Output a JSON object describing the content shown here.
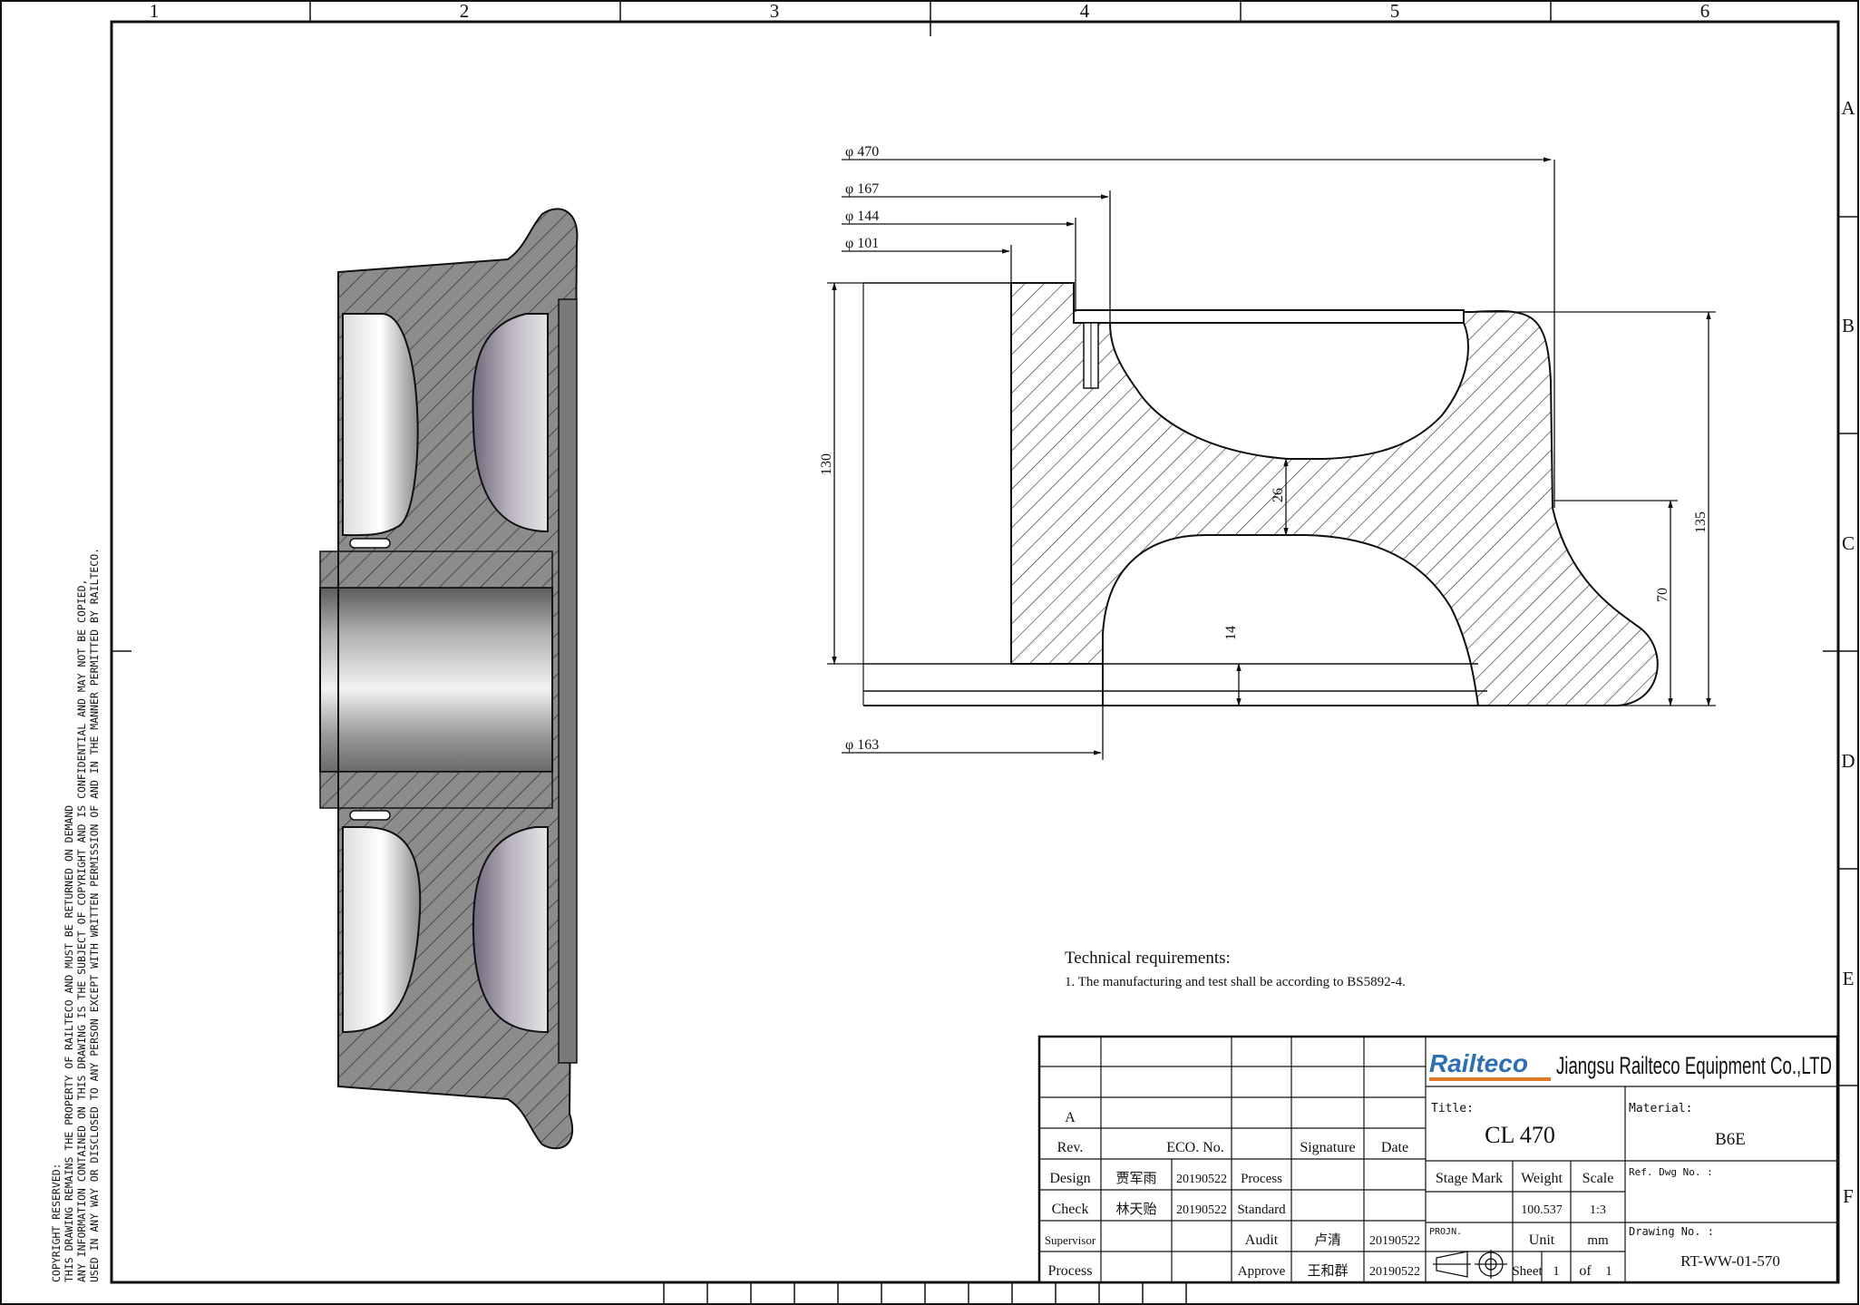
{
  "border": {
    "columns": [
      "1",
      "2",
      "3",
      "4",
      "5",
      "6"
    ],
    "rows": [
      "A",
      "B",
      "C",
      "D",
      "E",
      "F"
    ]
  },
  "copyright": [
    "COPYRIGHT RESERVED:",
    "THIS DRAWING REMAINS THE PROPERTY OF RAILTECO AND MUST BE RETURNED ON DEMAND",
    "ANY INFORMATION CONTAINED ON THIS DRAWING IS THE SUBJECT OF COPYRIGHT AND IS CONFIDENTIAL AND MAY NOT BE COPIED,",
    "USED IN ANY WAY OR DISCLOSED TO ANY PERSON EXCEPT WITH WRITTEN PERMISSION OF AND IN THE MANNER PERMITTED BY RAILTECO."
  ],
  "dimensions": {
    "d470": "470",
    "d167": "167",
    "d144": "144",
    "d101": "101",
    "d163": "163",
    "h130": "130",
    "h135": "135",
    "h70": "70",
    "t26": "26",
    "t14": "14",
    "diameter_symbol": "φ"
  },
  "technical_requirements": {
    "title": "Technical requirements:",
    "item1": "1. The manufacturing and test shall be according to BS5892-4."
  },
  "title_block": {
    "company_logo": "Railteco",
    "company_name": "Jiangsu Railteco Equipment Co.,LTD",
    "rev_letter": "A",
    "headers": {
      "rev": "Rev.",
      "eco": "ECO. No.",
      "signature": "Signature",
      "date": "Date"
    },
    "rows": [
      {
        "role": "Design",
        "name": "贾军雨",
        "date": "20190522",
        "role2": "Process",
        "name2": "",
        "date2": ""
      },
      {
        "role": "Check",
        "name": "林天贻",
        "date": "20190522",
        "role2": "Standard",
        "name2": "",
        "date2": ""
      },
      {
        "role": "Supervisor",
        "name": "",
        "date": "",
        "role2": "Audit",
        "name2": "卢清",
        "date2": "20190522"
      },
      {
        "role": "Process",
        "name": "",
        "date": "",
        "role2": "Approve",
        "name2": "王和群",
        "date2": "20190522"
      }
    ],
    "title_label": "Title:",
    "title_value": "CL 470",
    "material_label": "Material:",
    "material_value": "B6E",
    "stage_mark_label": "Stage Mark",
    "weight_label": "Weight",
    "weight_value": "100.537",
    "scale_label": "Scale",
    "scale_value": "1:3",
    "ref_dwg_label": "Ref. Dwg No. :",
    "projn_label": "PROJN.",
    "unit_label": "Unit",
    "unit_value": "mm",
    "sheet_label": "Sheet",
    "sheet_value": "1",
    "of_label": "of",
    "of_value": "1",
    "drawing_no_label": "Drawing No. :",
    "drawing_no_value": "RT-WW-01-570"
  },
  "colors": {
    "line": "#111111",
    "section_fill": "#8c8c8c",
    "logo_blue": "#2d6fb5",
    "logo_orange": "#e07b25"
  }
}
